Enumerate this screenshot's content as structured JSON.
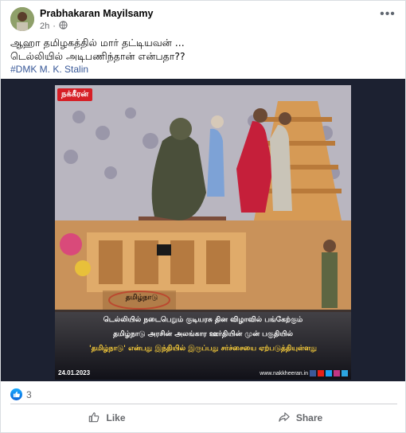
{
  "post": {
    "author": "Prabhakaran Mayilsamy",
    "time": "2h",
    "more_icon": "ellipsis-icon",
    "text_lines": [
      "ஆஹா தமிழகத்தில் மார் தட்டியவன் ...",
      "டெல்லியில் அடிபணிந்தான் என்பதா??"
    ],
    "hashtag": "#DMK M. K. Stalin"
  },
  "image": {
    "brand": "நக்கீரன்",
    "float_label": "தமிழ்நாடு",
    "caption_lines": [
      "டெல்லியில் நடைபெறும் குடியரசு தின விழாவில் பங்கேற்கும்",
      "தமிழ்நாடு அரசின் அலங்கார ஊர்தியின் முன் பகுதியில்",
      "'தமிழ்நாடு' என்பது இந்தியில் இருப்பது சர்ச்சையை ஏற்படுத்தியுள்ளது"
    ],
    "date": "24.01.2023",
    "site": "www.nakkheeran.in"
  },
  "reactions": {
    "count": "3"
  },
  "actions": {
    "like": "Like",
    "share": "Share"
  },
  "colors": {
    "accent": "#1877f2",
    "secondary_text": "#65676b",
    "hashtag": "#385898",
    "caption_yellow": "#ffd23a"
  }
}
